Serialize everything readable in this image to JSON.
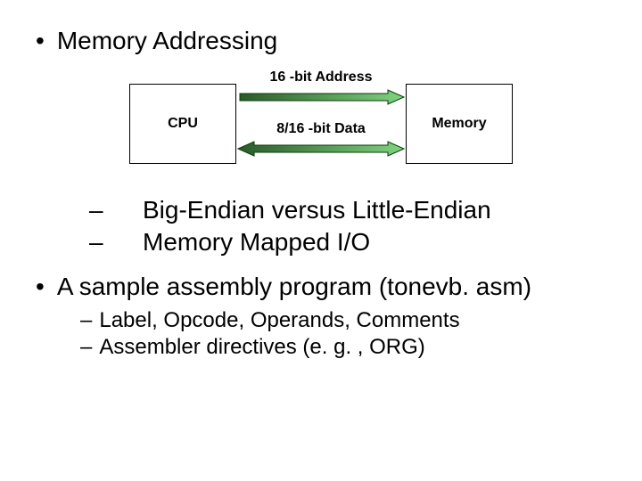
{
  "bullets": {
    "b1": "Memory Addressing",
    "b2": "A sample assembly program (tonevb. asm)"
  },
  "diagram": {
    "cpu": "CPU",
    "memory": "Memory",
    "address_label": "16 -bit Address",
    "data_label": "8/16 -bit Data"
  },
  "sub1": {
    "s1": "Big-Endian versus Little-Endian",
    "s2": "Memory Mapped I/O"
  },
  "sub2": {
    "s1": "Label, Opcode, Operands, Comments",
    "s2": "Assembler directives (e. g. , ORG)"
  },
  "glyphs": {
    "bullet": "•",
    "dash": "–"
  }
}
